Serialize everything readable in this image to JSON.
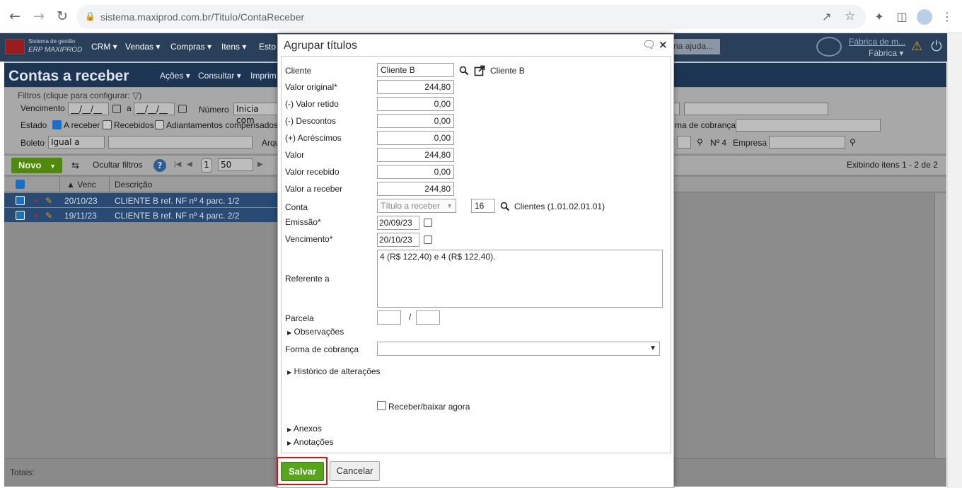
{
  "browser": {
    "url": "sistema.maxiprod.com.br/Titulo/ContaReceber"
  },
  "app": {
    "logo_line1": "Sistema de gestão",
    "logo_line2": "ERP MAXIPROD",
    "menus": [
      "CRM",
      "Vendas",
      "Compras",
      "Itens",
      "Esto"
    ],
    "help_text": "na ajuda...",
    "company_name": "Fábrica de m...",
    "company_sub": "Fábrica"
  },
  "page": {
    "title": "Contas a receber",
    "band_menus": [
      "Ações",
      "Consultar",
      "Imprim"
    ]
  },
  "filters": {
    "legend": "Filtros (clique para configurar:",
    "vencimento_label": "Vencimento",
    "date_placeholder": "__/__/__",
    "a_label": "a",
    "numero_label": "Número",
    "numero_value": "Inicia com",
    "estado_label": "Estado",
    "a_receber": "A receber",
    "recebidos": "Recebidos",
    "adiantamentos": "Adiantamentos compensados",
    "boleto_label": "Boleto",
    "boleto_value": "Igual a",
    "arq_label": "Arqu",
    "forma_cobranca_label": "ma de cobrança",
    "no_label": "Nº 4",
    "empresa_label": "Empresa"
  },
  "toolbar": {
    "novo": "Novo",
    "ocultar_filtros": "Ocultar filtros",
    "page_value": "1",
    "page_size": "50",
    "exibindo": "Exibindo itens 1 - 2 de 2"
  },
  "grid": {
    "col_venc": "Venc",
    "col_descricao": "Descrição",
    "rows": [
      {
        "venc": "20/10/23",
        "descricao": "CLIENTE B ref. NF nº 4 parc. 1/2"
      },
      {
        "venc": "19/11/23",
        "descricao": "CLIENTE B ref. NF nº 4 parc. 2/2"
      }
    ],
    "totais": "Totais:"
  },
  "dialog": {
    "title": "Agrupar títulos",
    "cliente_label": "Cliente",
    "cliente_value": "Cliente B",
    "cliente_link": "Cliente B",
    "valor_original_label": "Valor original*",
    "valor_original": "244,80",
    "valor_retido_label": "(-) Valor retido",
    "valor_retido": "0,00",
    "descontos_label": "(-) Descontos",
    "descontos": "0,00",
    "acrescimos_label": "(+) Acréscimos",
    "acrescimos": "0,00",
    "valor_label": "Valor",
    "valor": "244,80",
    "valor_recebido_label": "Valor recebido",
    "valor_recebido": "0,00",
    "valor_a_receber_label": "Valor a receber",
    "valor_a_receber": "244,80",
    "conta_label": "Conta",
    "conta_select": "Título a receber",
    "conta_number": "16",
    "conta_desc": "Clientes (1.01.02.01.01)",
    "emissao_label": "Emissão*",
    "emissao": "20/09/23",
    "vencimento_label": "Vencimento*",
    "vencimento": "20/10/23",
    "referente_label": "Referente a",
    "referente_value": "4 (R$ 122,40) e 4 (R$ 122,40).",
    "parcela_label": "Parcela",
    "parcela_sep": "/",
    "observacoes": "Observações",
    "forma_cobranca_label": "Forma de cobrança",
    "historico": "Histórico de alterações",
    "receber_baixar": "Receber/baixar agora",
    "anexos": "Anexos",
    "anotacoes": "Anotações",
    "salvar": "Salvar",
    "cancelar": "Cancelar"
  },
  "colors": {
    "header_bg": "#2a3f5a",
    "band_bg": "#1c3553",
    "salvar_green": "#57a51a",
    "highlight_red": "#e01010",
    "row_selected": "#284a73"
  }
}
